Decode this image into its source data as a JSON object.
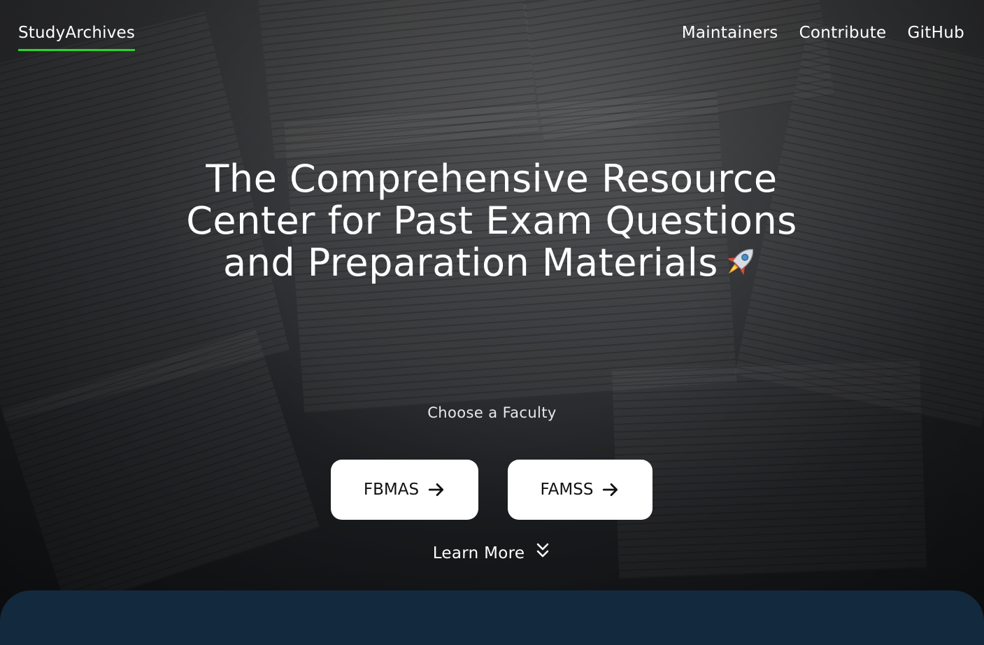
{
  "nav": {
    "logo": "StudyArchives",
    "links": [
      "Maintainers",
      "Contribute",
      "GitHub"
    ],
    "accent_color": "#2fd22f"
  },
  "hero": {
    "title": "The Comprehensive Resource Center for Past Exam Questions and Preparation Materials",
    "title_icon": "rocket-icon",
    "faculty_prompt": "Choose a Faculty",
    "faculties": [
      {
        "label": "FBMAS",
        "icon": "arrow-right-icon"
      },
      {
        "label": "FAMSS",
        "icon": "arrow-right-icon"
      }
    ],
    "learn_more": "Learn More",
    "learn_more_icon": "chevrons-down-icon"
  },
  "colors": {
    "next_section_bg": "#13293d",
    "button_bg": "#ffffff"
  }
}
